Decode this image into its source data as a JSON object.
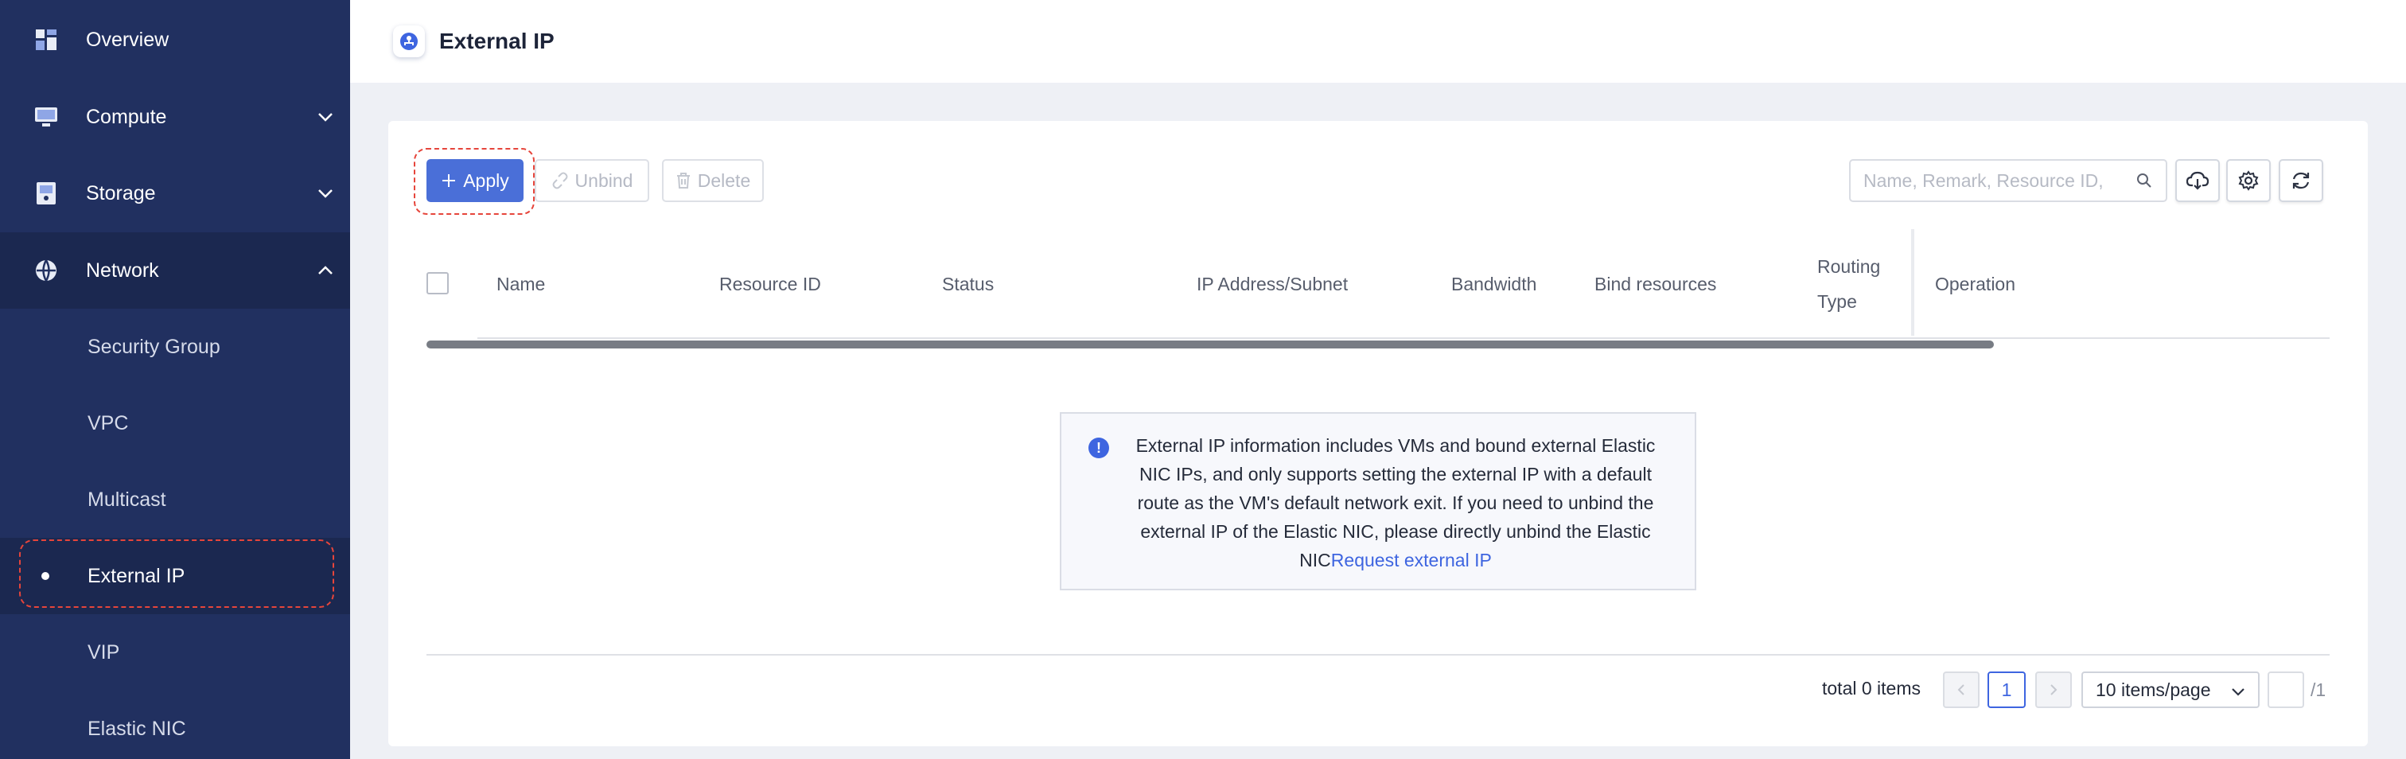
{
  "sidebar": {
    "items": [
      {
        "label": "Overview",
        "icon": "dashboard-icon"
      },
      {
        "label": "Compute",
        "icon": "monitor-icon",
        "expanded": false
      },
      {
        "label": "Storage",
        "icon": "storage-icon",
        "expanded": false
      },
      {
        "label": "Network",
        "icon": "network-icon",
        "expanded": true
      }
    ],
    "network_children": [
      "Security Group",
      "VPC",
      "Multicast",
      "External IP",
      "VIP",
      "Elastic NIC"
    ],
    "selected": "External IP"
  },
  "header": {
    "title": "External IP",
    "icon": "external-ip-icon"
  },
  "toolbar": {
    "apply_label": "Apply",
    "unbind_label": "Unbind",
    "delete_label": "Delete",
    "search_placeholder": "Name, Remark, Resource ID,",
    "download_icon": "cloud-download-icon",
    "settings_icon": "settings-icon",
    "refresh_icon": "refresh-icon"
  },
  "table": {
    "columns": [
      "Name",
      "Resource ID",
      "Status",
      "IP Address/Subnet",
      "Bandwidth",
      "Bind resources",
      "Routing Type",
      "Operation"
    ],
    "routing_line1": "Routing",
    "routing_line2": "Type",
    "rows": []
  },
  "empty": {
    "message": "External IP information includes VMs and bound external Elastic NIC IPs, and only supports setting the external IP with a default route as the VM's default network exit. If you need to unbind the external IP of the Elastic NIC, please directly unbind the Elastic NIC",
    "link": "Request external IP"
  },
  "pagination": {
    "total": "total 0 items",
    "current_page": "1",
    "page_size": "10 items/page",
    "of_pages": "/1"
  },
  "colors": {
    "sidebar_bg": "#213060",
    "sidebar_active": "#1b2850",
    "primary": "#4a6fd8",
    "link": "#3e65e0",
    "highlight_outline": "#e6453b"
  }
}
